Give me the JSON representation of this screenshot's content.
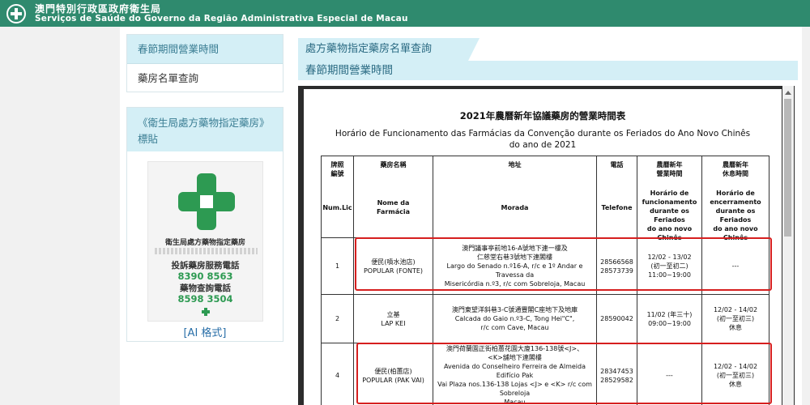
{
  "header": {
    "title_zh": "澳門特別行政區政府衛生局",
    "title_pt": "Serviços de Saúde do Governo da Região Administrativa Especial de Macau"
  },
  "sidebar": {
    "items": [
      {
        "label": "春節期間營業時間"
      },
      {
        "label": "藥房名單查詢"
      }
    ],
    "panel_title": "《衛生局處方藥物指定藥房》標貼",
    "badge": {
      "title": "衛生局處方藥物指定藥房",
      "complaint_label": "投訴藥房服務電話",
      "complaint_phone": "8390 8563",
      "query_label": "藥物查詢電話",
      "query_phone": "8598 3504"
    },
    "ai_link": "[AI 格式]"
  },
  "main": {
    "tab_label": "處方藥物指定藥房名單查詢",
    "section_title": "春節期間營業時間"
  },
  "document": {
    "title_zh": "2021年農曆新年協議藥房的營業時間表",
    "title_pt_line1": "Horário de Funcionamento das Farmácias da Convenção durante os Feriados do Ano Novo Chinês",
    "title_pt_line2": "do ano de 2021",
    "columns": [
      {
        "zh": "牌照\n編號",
        "pt": "Num.Lic"
      },
      {
        "zh": "藥房名稱",
        "pt": "Nome da\nFarmácia"
      },
      {
        "zh": "地址",
        "pt": "Morada"
      },
      {
        "zh": "電話",
        "pt": "Telefone"
      },
      {
        "zh": "農曆新年\n營業時間",
        "pt": "Horário de\nfuncionamento\ndurante os Feriados\ndo ano novo Chinês"
      },
      {
        "zh": "農曆新年\n休息時間",
        "pt": "Horário de\nencerramento\ndurante os Feriados\ndo ano novo Chinês"
      }
    ],
    "rows": [
      {
        "num": "1",
        "name": "便民(噴水池店)\nPOPULAR (FONTE)",
        "address": "澳門議事亭前地16-A號地下連一樓及\n仁慈堂右巷3號地下連閣樓\nLargo do Senado n.º16-A, r/c e 1º Andar e Travessa da\nMisericórdia n.º3, r/c com Sobreloja, Macau",
        "phone": "28566568\n28573739",
        "open": "12/02 - 13/02\n(初一至初二)\n11:00~19:00",
        "closed": "---"
      },
      {
        "num": "2",
        "name": "立基\nLAP KEI",
        "address": "澳門東望洋斜巷3-C號通豐閣C座地下及地庫\nCalcada do Gaio n.º3-C, Tong Hei\"C\",\nr/c com Cave, Macau",
        "phone": "28590042",
        "open": "11/02 (年三十)\n09:00~19:00",
        "closed": "12/02 - 14/02\n(初一至初三)\n休息"
      },
      {
        "num": "4",
        "name": "便民(柏蕙店)\nPOPULAR (PAK VAI)",
        "address": "澳門荷蘭園正街柏蕙花園大廈136-138號<J>、\n<K>舖地下連閣樓\nAvenida do Conselheiro Ferreira de Almeida  Edifício Pak\nVai Plaza nos.136-138 Lojas <J> e <K> r/c com Sobreloja\nMacau",
        "phone": "28347453\n28529582",
        "open": "---",
        "closed": "12/02 - 14/02\n(初一至初三)\n休息"
      }
    ]
  }
}
